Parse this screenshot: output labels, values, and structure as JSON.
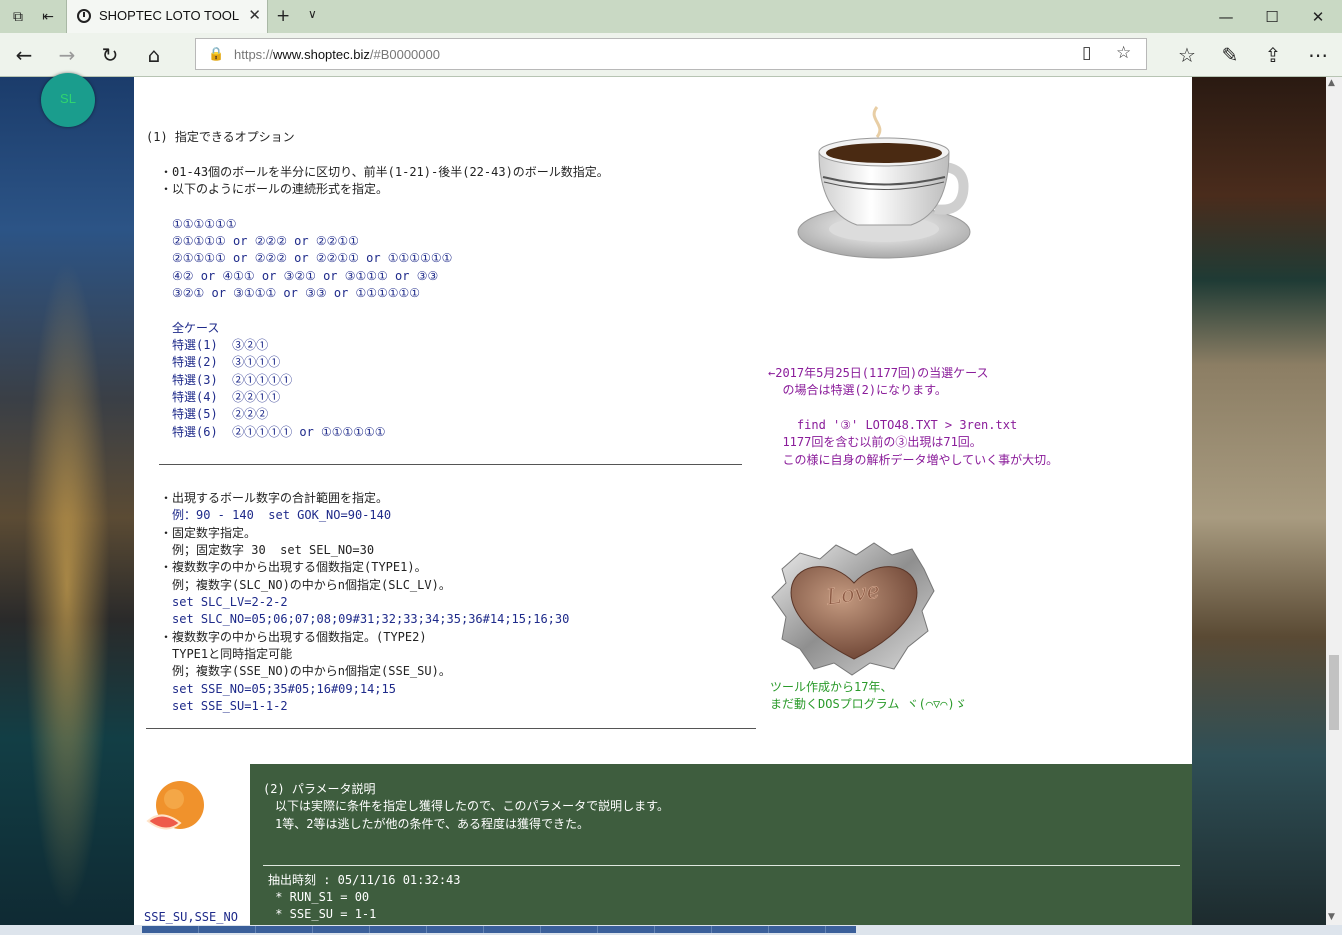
{
  "browser": {
    "tab_title": "SHOPTEC LOTO TOOL",
    "url_prefix": "https://",
    "url_host": "www.shoptec.biz",
    "url_path": "/#B0000000",
    "icons": {
      "tab_actions": "tab-actions-icon",
      "set_aside": "set-aside-tabs-icon",
      "back": "back-arrow-icon",
      "forward": "forward-arrow-icon",
      "refresh": "refresh-icon",
      "home": "home-icon",
      "reading_view": "reading-view-icon",
      "favorite": "star-icon",
      "favorites_hub": "favorites-hub-icon",
      "notes": "pen-icon",
      "share": "share-icon",
      "more": "more-icon"
    }
  },
  "badge": {
    "label": "SL"
  },
  "page": {
    "section1_title": "(1) 指定できるオプション",
    "options_intro": [
      "・01-43個のボールを半分に区切り、前半(1-21)-後半(22-43)のボール数指定。",
      "・以下のようにボールの連続形式を指定。"
    ],
    "patterns": [
      "①①①①①①",
      "②①①①① or ②②② or ②②①①",
      "②①①①① or ②②② or ②②①① or ①①①①①①",
      "④② or ④①① or ③②① or ③①①① or ③③",
      "③②① or ③①①① or ③③ or ①①①①①①"
    ],
    "all_cases_title": "全ケース",
    "special_cases": [
      "特選(1)  ③②①",
      "特選(2)  ③①①①",
      "特選(3)  ②①①①①",
      "特選(4)  ②②①①",
      "特選(5)  ②②②",
      "特選(6)  ②①①①① or ①①①①①①"
    ],
    "range_lines": [
      "・出現するボール数字の合計範囲を指定。",
      "・固定数字指定。",
      "・複数数字の中から出現する個数指定(TYPE1)。",
      "・複数数字の中から出現する個数指定。(TYPE2)"
    ],
    "range_example": "例：90 - 140  set GOK_NO=90-140",
    "fixed_example": "例；固定数字 30  set SEL_NO=30",
    "type1_example": "例；複数字(SLC_NO)の中からn個指定(SLC_LV)。",
    "type1_set1": "set SLC_LV=2-2-2",
    "type1_set2": "set SLC_NO=05;06;07;08;09#31;32;33;34;35;36#14;15;16;30",
    "type2_note": "TYPE1と同時指定可能",
    "type2_example": "例；複数字(SSE_NO)の中からn個指定(SSE_SU)。",
    "type2_set1": "set SSE_NO=05;35#05;16#09;14;15",
    "type2_set2": "set SSE_SU=1-1-2",
    "side_note": [
      "←2017年5月25日(1177回)の当選ケース",
      "  の場合は特選(2)になります。",
      "",
      "    find '③' LOTO48.TXT > 3ren.txt",
      "  1177回を含む以前の③出現は71回。",
      "  この様に自身の解析データ増やしていく事が大切。"
    ],
    "choco_note": [
      "ツール作成から17年、",
      "まだ動くDOSプログラム ヾ(⌒▽⌒)ゞ"
    ],
    "choco_word": "Love",
    "left_bottom_label": "SSE_SU,SSE_NO",
    "section2": {
      "title": "(2) パラメータ説明",
      "lines": [
        "以下は実際に条件を指定し獲得したので、このパラメータで説明します。",
        "1等、2等は逃したが他の条件で、ある程度は獲得できた。"
      ],
      "output_lines": [
        "抽出時刻 : 05/11/16 01:32:43",
        " * RUN_S1 = 00",
        " * SSE_SU = 1-1"
      ]
    }
  }
}
